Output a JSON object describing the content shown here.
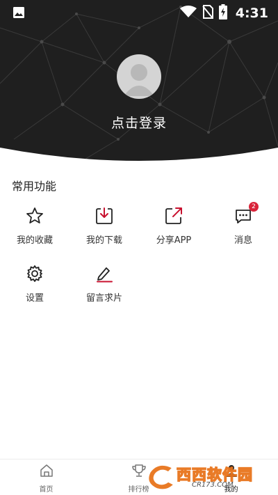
{
  "status_bar": {
    "time": "4:31",
    "icons": [
      "image-icon",
      "wifi-icon",
      "no-sim-icon",
      "battery-charging-icon"
    ]
  },
  "profile": {
    "login_text": "点击登录"
  },
  "common_functions": {
    "title": "常用功能",
    "items": [
      {
        "label": "我的收藏",
        "icon": "star-icon"
      },
      {
        "label": "我的下载",
        "icon": "download-icon"
      },
      {
        "label": "分享APP",
        "icon": "share-icon"
      },
      {
        "label": "消息",
        "icon": "message-icon",
        "badge": "2"
      },
      {
        "label": "设置",
        "icon": "gear-icon"
      },
      {
        "label": "留言求片",
        "icon": "edit-icon"
      }
    ]
  },
  "tab_bar": {
    "tabs": [
      {
        "label": "首页",
        "icon": "home-icon"
      },
      {
        "label": "排行榜",
        "icon": "trophy-icon"
      },
      {
        "label": "我的",
        "icon": "user-icon",
        "active": true
      }
    ]
  },
  "watermark": {
    "main": "西西软件园",
    "sub": "CR173.COM"
  },
  "colors": {
    "header_bg": "#1f1f1f",
    "accent_red": "#c8102e",
    "badge": "#d9243a"
  }
}
